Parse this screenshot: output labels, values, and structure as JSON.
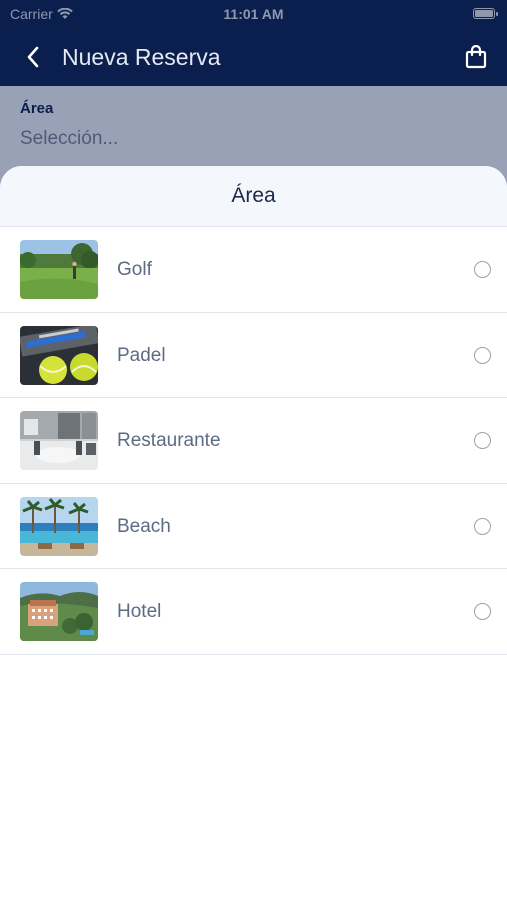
{
  "status_bar": {
    "carrier": "Carrier",
    "time": "11:01 AM"
  },
  "nav": {
    "title": "Nueva Reserva",
    "back_icon": "chevron-left-icon",
    "bag_icon": "shopping-bag-icon"
  },
  "form": {
    "area_label": "Área",
    "area_placeholder": "Selección..."
  },
  "sheet": {
    "title": "Área",
    "items": [
      {
        "label": "Golf",
        "image": "golf-course-photo"
      },
      {
        "label": "Padel",
        "image": "tennis-balls-photo"
      },
      {
        "label": "Restaurante",
        "image": "restaurant-interior-photo"
      },
      {
        "label": "Beach",
        "image": "beach-pool-palms-photo"
      },
      {
        "label": "Hotel",
        "image": "hotel-aerial-photo"
      }
    ]
  },
  "colors": {
    "primary": "#0a1f4e",
    "sheet_header": "#f4f7fb",
    "item_text": "#5d6b84"
  }
}
